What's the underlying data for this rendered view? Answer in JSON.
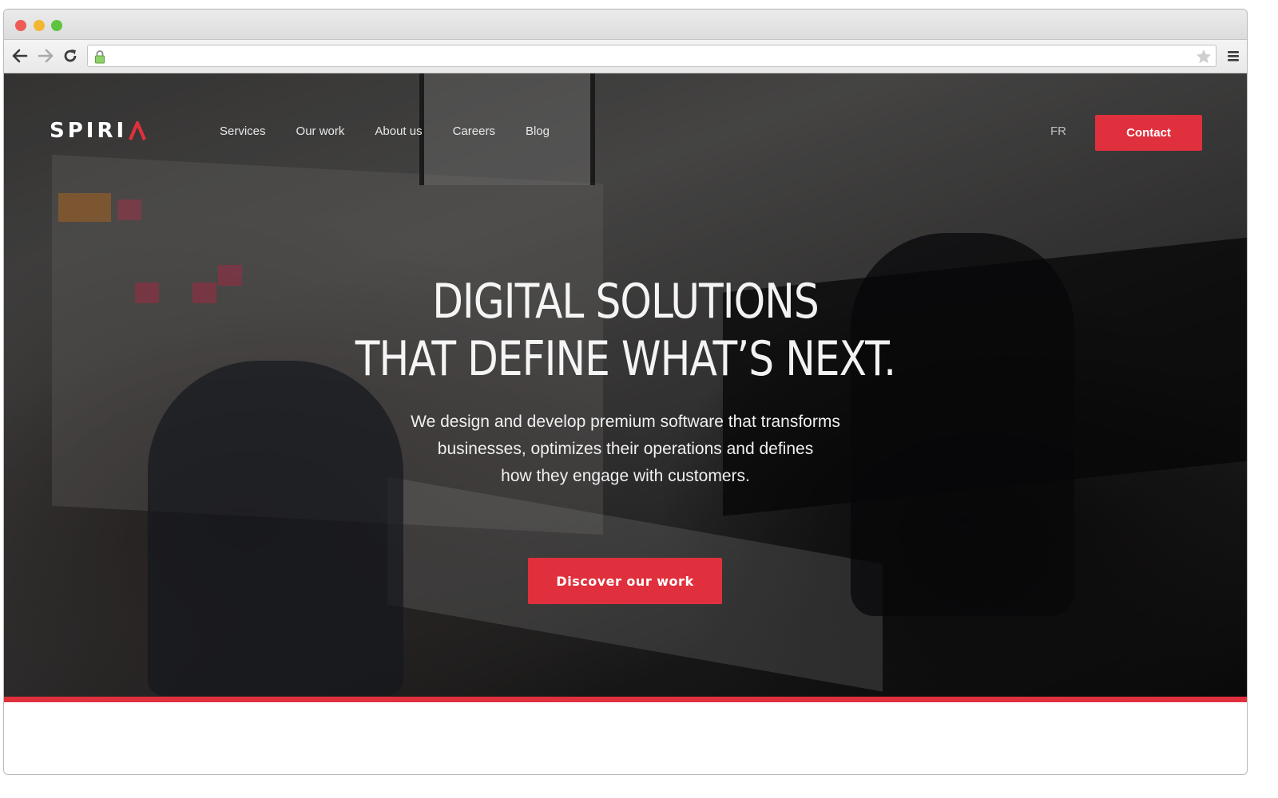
{
  "browser": {
    "traffic_lights": {
      "close": "close-window",
      "minimize": "minimize-window",
      "maximize": "maximize-window"
    },
    "nav": {
      "back": "back-arrow-icon",
      "forward": "forward-arrow-icon",
      "reload": "reload-icon"
    },
    "address": {
      "value": "",
      "secure_icon": "lock-icon",
      "bookmark_icon": "star-icon"
    },
    "menu_icon": "hamburger-menu-icon"
  },
  "site": {
    "logo": {
      "text": "SPIRI",
      "accent_glyph": "Λ"
    },
    "nav_items": [
      {
        "label": "Services"
      },
      {
        "label": "Our work"
      },
      {
        "label": "About us"
      },
      {
        "label": "Careers"
      },
      {
        "label": "Blog"
      }
    ],
    "language_toggle": "FR",
    "contact_button": "Contact",
    "hero": {
      "headline_lines": [
        "DIGITAL SOLUTIONS",
        "THAT DEFINE WHAT’S NEXT."
      ],
      "subtext_lines": [
        "We design and develop premium software that transforms",
        "businesses, optimizes their operations and defines",
        "how they engage with customers."
      ],
      "cta_button": "Discover our work"
    },
    "colors": {
      "accent": "#e0303d",
      "text": "#ffffff"
    }
  }
}
